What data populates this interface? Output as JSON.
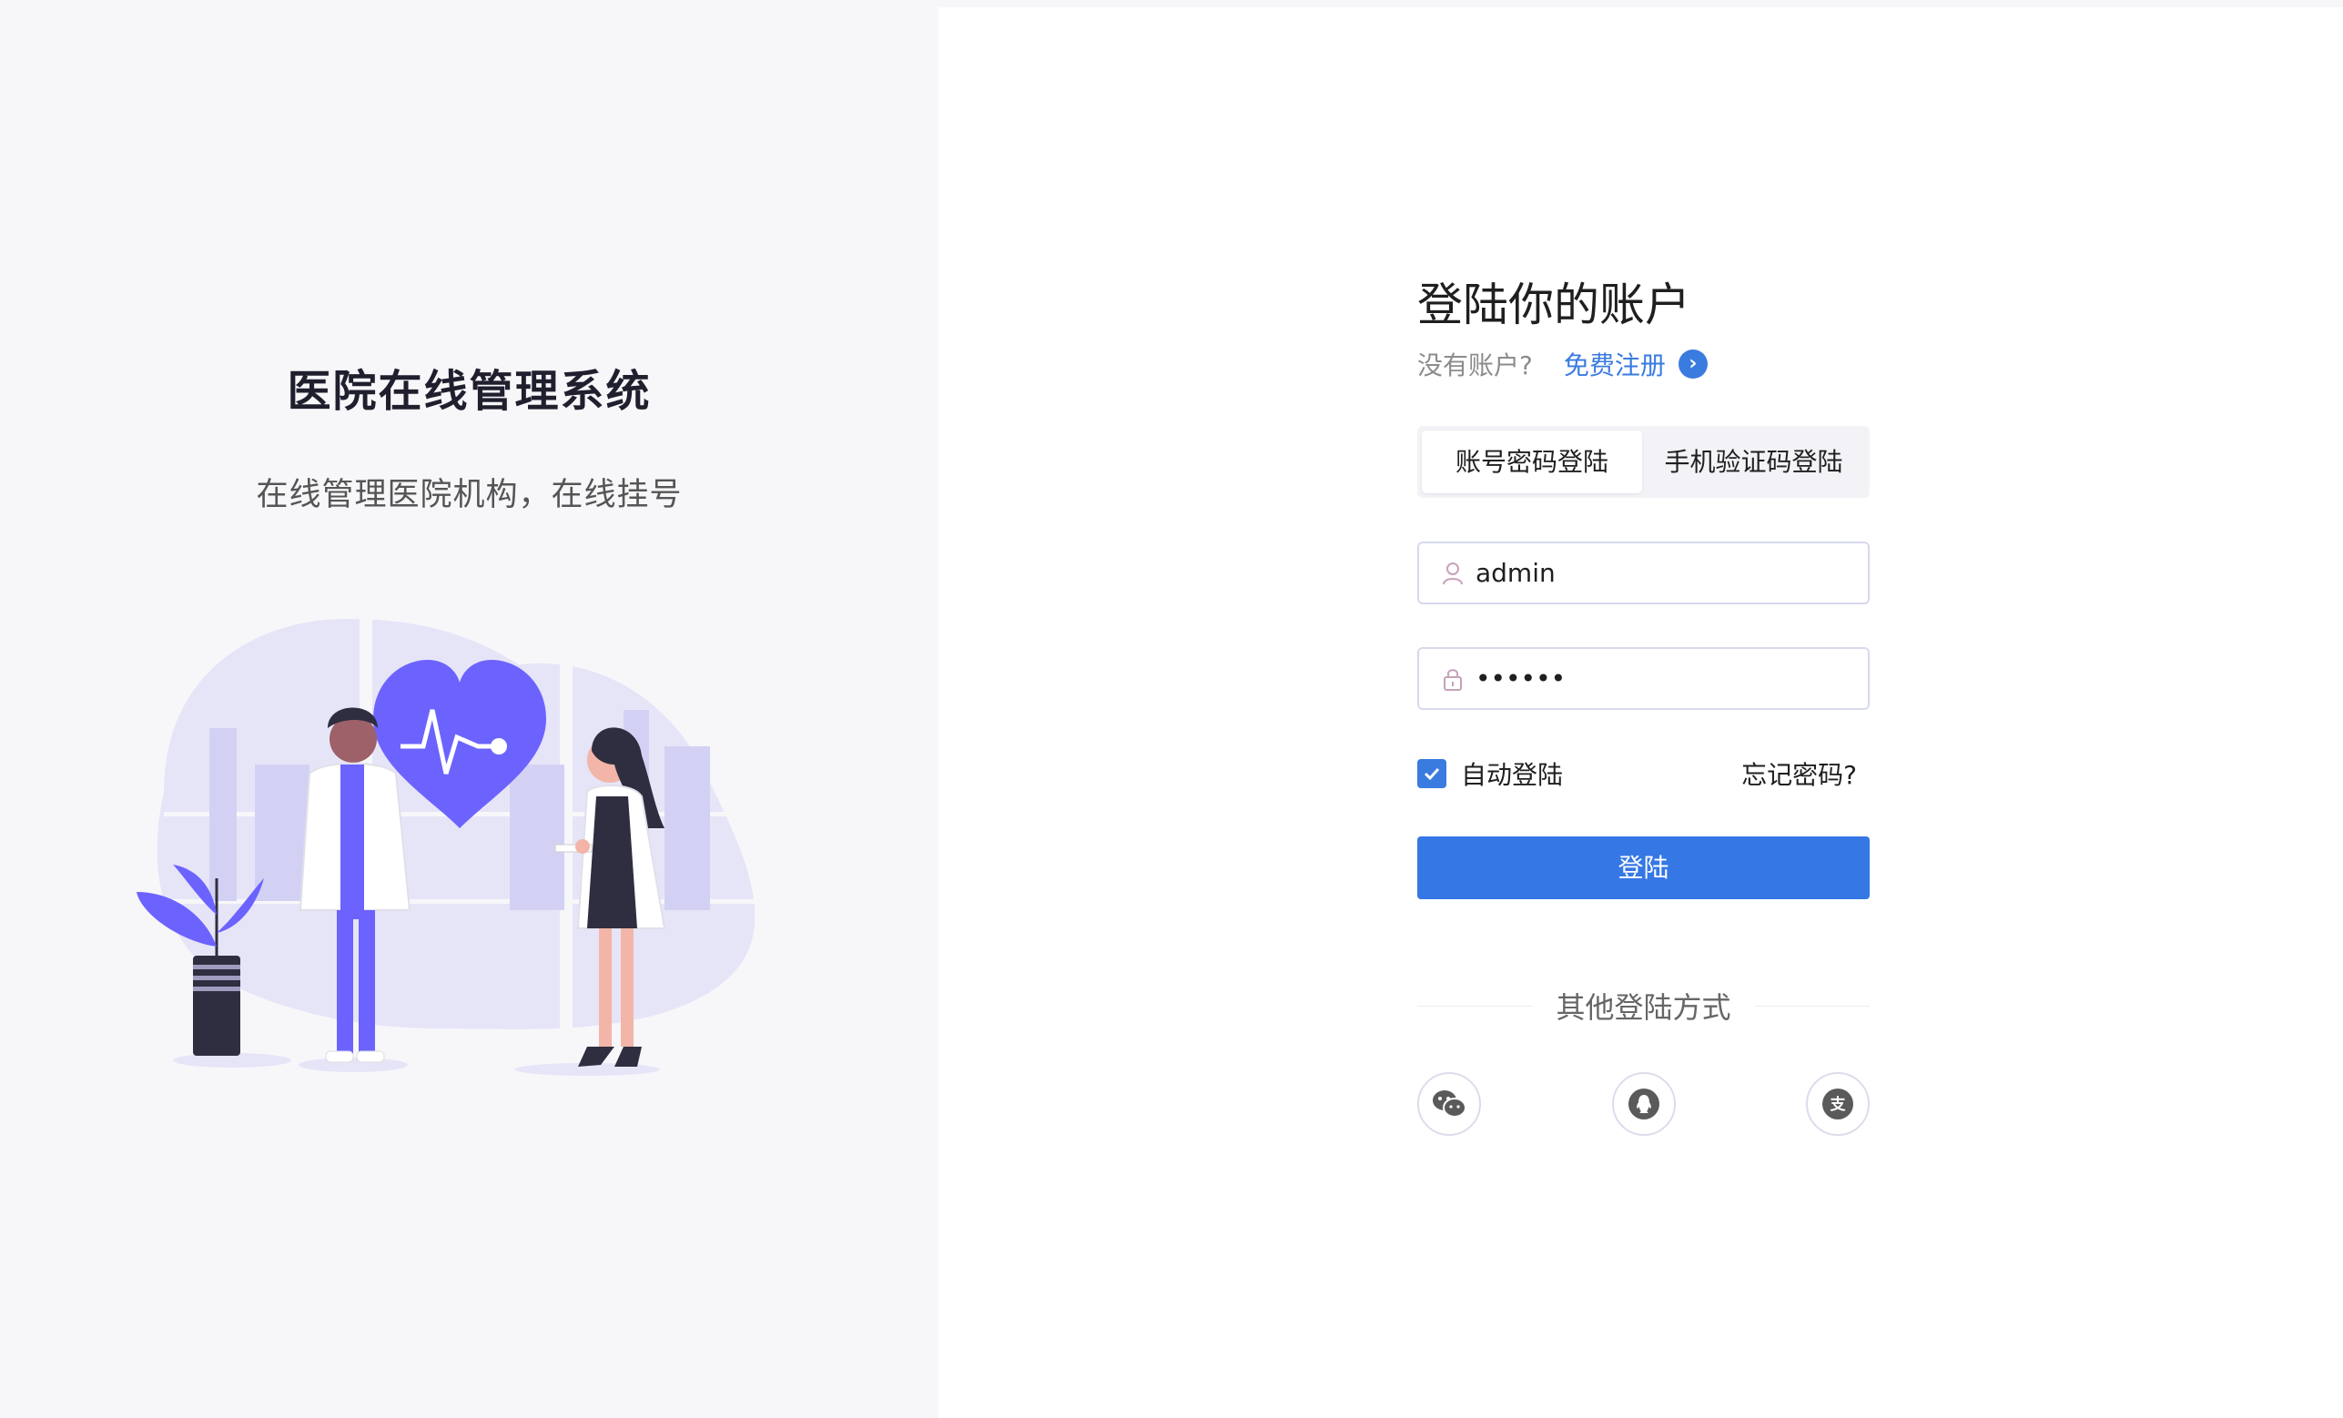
{
  "brand": {
    "title": "医院在线管理系统",
    "subtitle": "在线管理医院机构，在线挂号"
  },
  "login": {
    "title": "登陆你的账户",
    "no_account": "没有账户?",
    "register_link": "免费注册",
    "tabs": [
      {
        "label": "账号密码登陆",
        "active": true
      },
      {
        "label": "手机验证码登陆",
        "active": false
      }
    ],
    "username": {
      "value": "admin",
      "icon": "user-icon"
    },
    "password": {
      "value": "••••••",
      "icon": "lock-icon"
    },
    "remember_label": "自动登陆",
    "remember_checked": true,
    "forgot_label": "忘记密码?",
    "submit_label": "登陆",
    "other_methods_label": "其他登陆方式",
    "social": [
      {
        "name": "wechat-icon"
      },
      {
        "name": "qq-icon"
      },
      {
        "name": "alipay-icon"
      }
    ]
  },
  "colors": {
    "accent": "#3577e5",
    "illustration": "#6c63ff",
    "page_bg": "#f7f7fa"
  }
}
